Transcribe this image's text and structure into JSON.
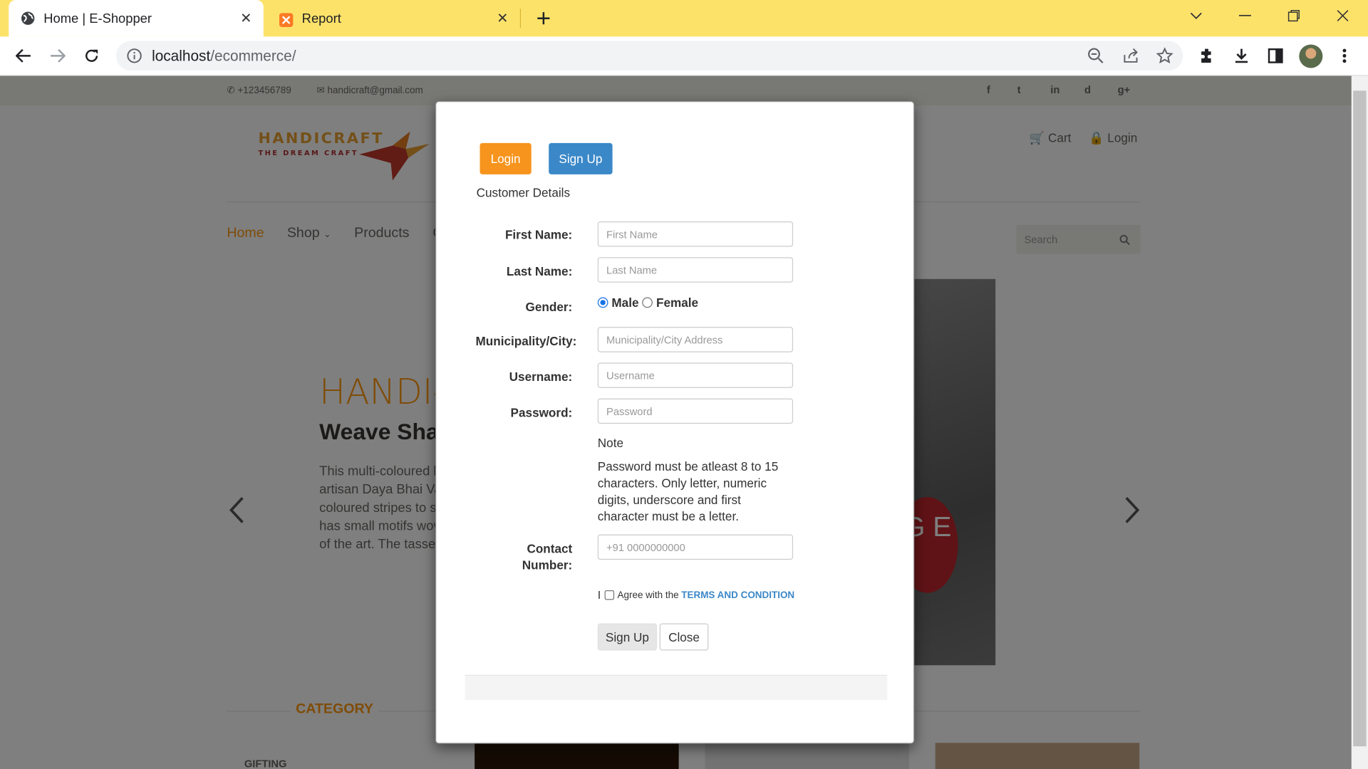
{
  "browser": {
    "tabs": [
      {
        "title": "Home | E-Shopper",
        "active": true
      },
      {
        "title": "Report",
        "active": false
      }
    ],
    "url_host": "localhost",
    "url_path": "/ecommerce/",
    "accent": "#fde26a"
  },
  "page": {
    "phone": "+123456789",
    "email": "handicraft@gmail.com",
    "social": [
      "f",
      "t",
      "in",
      "d",
      "g+"
    ],
    "logo_brand": "HANDICRAFT",
    "logo_tagline": "THE DREAM CRAFT",
    "header_links": {
      "cart": "Cart",
      "login": "Login"
    },
    "nav": [
      "Home",
      "Shop",
      "Products",
      "C"
    ],
    "search_placeholder": "Search",
    "hero": {
      "title": "HANDI-C",
      "subtitle": "Weave Shav",
      "desc": "This multi-coloured h artisan Daya Bhai Va coloured stripes to sl has small motifs wov of the art. The tassel",
      "badge": "G E"
    },
    "category_title": "CATEGORY",
    "category_first": "GIFTING",
    "accent": "#fe980f"
  },
  "modal": {
    "login_label": "Login",
    "signup_label": "Sign Up",
    "section_title": "Customer Details",
    "fields": {
      "first_name": {
        "label": "First Name:",
        "placeholder": "First Name"
      },
      "last_name": {
        "label": "Last Name:",
        "placeholder": "Last Name"
      },
      "gender": {
        "label": "Gender:",
        "options": [
          "Male",
          "Female"
        ],
        "selected": "Male"
      },
      "city": {
        "label": "Municipality/City:",
        "placeholder": "Municipality/City Address"
      },
      "username": {
        "label": "Username:",
        "placeholder": "Username"
      },
      "password": {
        "label": "Password:",
        "placeholder": "Password"
      },
      "contact": {
        "label_line1": "Contact",
        "label_line2": "Number:",
        "placeholder": "+91 0000000000"
      }
    },
    "note_title": "Note",
    "note_text": "Password must be atleast 8 to 15 characters. Only letter, numeric digits, underscore and first character must be a letter.",
    "agree_prefix": "I",
    "agree_text": "Agree with the",
    "terms_text": "TERMS AND CONDITION",
    "submit_label": "Sign Up",
    "close_label": "Close",
    "colors": {
      "login": "#f7941d",
      "signup": "#3b88c8"
    }
  }
}
